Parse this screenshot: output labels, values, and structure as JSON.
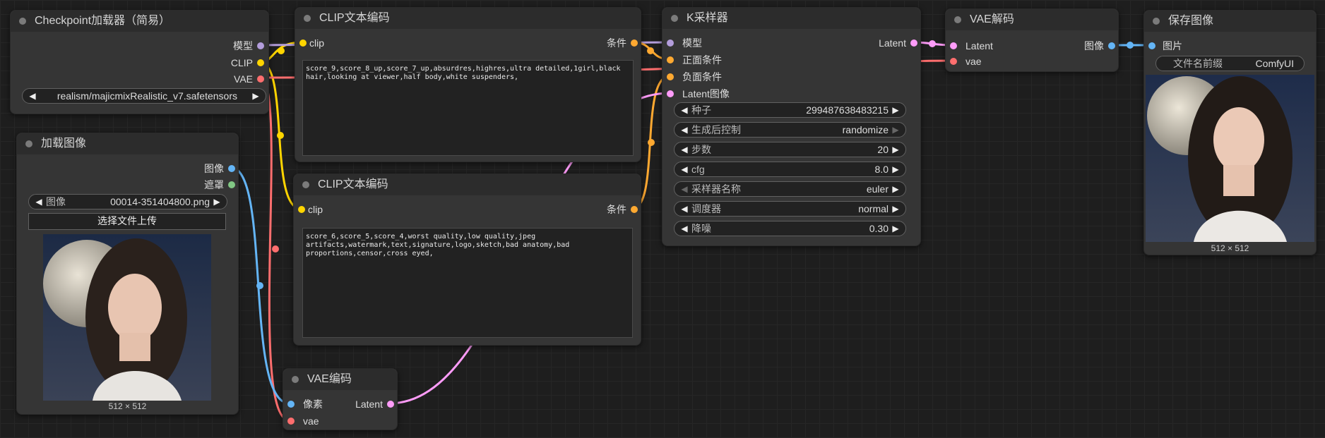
{
  "colors": {
    "model": "#b39ddb",
    "clip": "#ffd500",
    "vae": "#ff6e6e",
    "image": "#64b5f6",
    "mask": "#81c784",
    "conditioning": "#ffa931",
    "latent": "#ff9cf9"
  },
  "ckpt": {
    "title": "Checkpoint加载器（简易）",
    "out_model": "模型",
    "out_clip": "CLIP",
    "out_vae": "VAE",
    "ckpt_name": "realism/majicmixRealistic_v7.safetensors"
  },
  "load_image": {
    "title": "加载图像",
    "out_image": "图像",
    "out_mask": "遮罩",
    "image_label": "图像",
    "image_value": "00014-351404800.png",
    "upload_label": "选择文件上传",
    "size": "512 × 512"
  },
  "clip_pos": {
    "title": "CLIP文本编码",
    "in_clip": "clip",
    "out_cond": "条件",
    "text": "score_9,score_8_up,score_7_up,absurdres,highres,ultra detailed,1girl,black hair,looking at viewer,half body,white suspenders,"
  },
  "clip_neg": {
    "title": "CLIP文本编码",
    "in_clip": "clip",
    "out_cond": "条件",
    "text": "score_6,score_5,score_4,worst quality,low quality,jpeg artifacts,watermark,text,signature,logo,sketch,bad anatomy,bad proportions,censor,cross eyed,"
  },
  "vae_encode": {
    "title": "VAE编码",
    "in_pixels": "像素",
    "in_vae": "vae",
    "out_latent": "Latent"
  },
  "ksampler": {
    "title": "K采样器",
    "in_model": "模型",
    "in_pos": "正面条件",
    "in_neg": "负面条件",
    "in_latent": "Latent图像",
    "out_latent": "Latent",
    "widgets": [
      {
        "label": "种子",
        "value": "299487638483215"
      },
      {
        "label": "生成后控制",
        "value": "randomize"
      },
      {
        "label": "步数",
        "value": "20"
      },
      {
        "label": "cfg",
        "value": "8.0"
      },
      {
        "label": "采样器名称",
        "value": "euler"
      },
      {
        "label": "调度器",
        "value": "normal"
      },
      {
        "label": "降噪",
        "value": "0.30"
      }
    ]
  },
  "vae_decode": {
    "title": "VAE解码",
    "in_latent": "Latent",
    "in_vae": "vae",
    "out_image": "图像"
  },
  "save_image": {
    "title": "保存图像",
    "in_images": "图片",
    "prefix_label": "文件名前缀",
    "prefix_value": "ComfyUI",
    "size": "512 × 512"
  }
}
